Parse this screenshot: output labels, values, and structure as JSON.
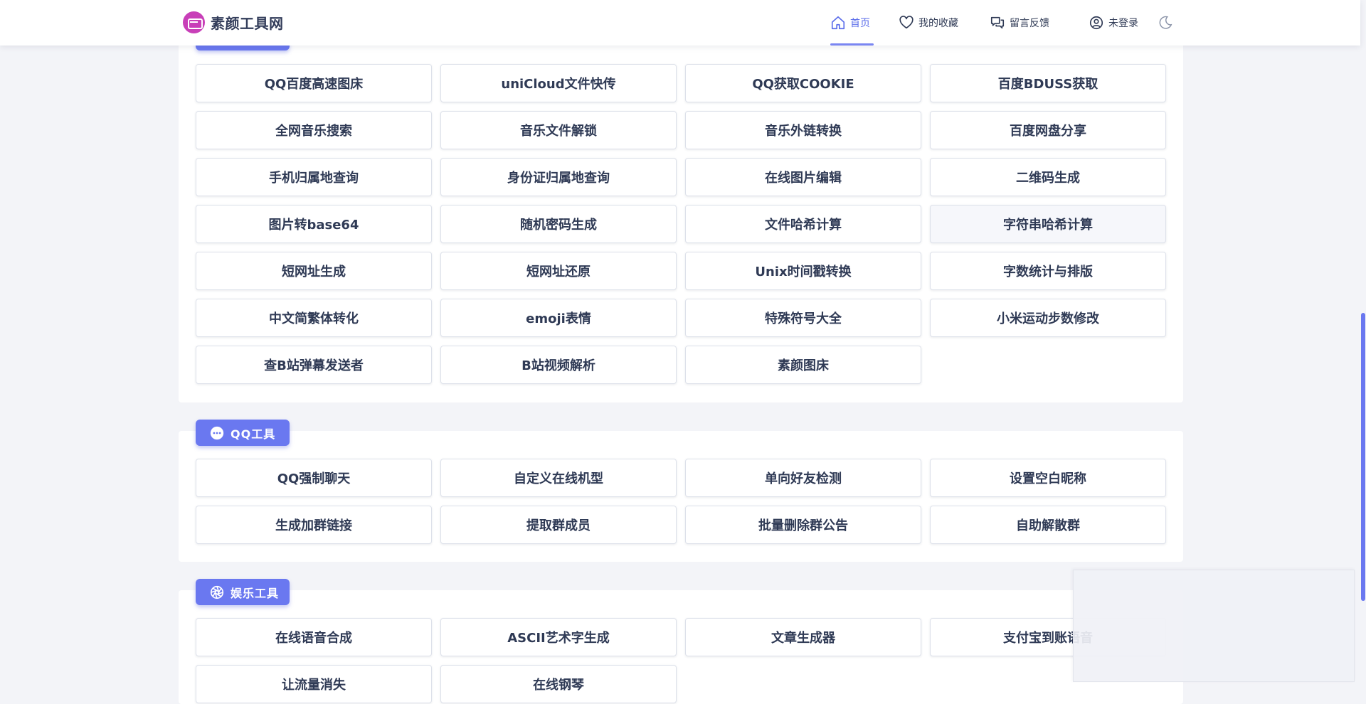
{
  "site": {
    "title": "素颜工具网",
    "accent": "#6a78f0",
    "logo_color": "#c83fb8"
  },
  "nav": [
    {
      "label": "首页",
      "icon": "home-icon"
    },
    {
      "label": "我的收藏",
      "icon": "heart-icon"
    },
    {
      "label": "留言反馈",
      "icon": "chat-icon"
    },
    {
      "label": "未登录",
      "icon": "user-icon"
    },
    {
      "icon": "moon-icon"
    }
  ],
  "sections": [
    {
      "title": "",
      "items": [
        "QQ百度高速图床",
        "uniCloud文件快传",
        "QQ获取COOKIE",
        "百度BDUSS获取",
        "全网音乐搜索",
        "音乐文件解锁",
        "音乐外链转换",
        "百度网盘分享",
        "手机归属地查询",
        "身份证归属地查询",
        "在线图片编辑",
        "二维码生成",
        "图片转base64",
        "随机密码生成",
        "文件哈希计算",
        "字符串哈希计算",
        "短网址生成",
        "短网址还原",
        "Unix时间戳转换",
        "字数统计与排版",
        "中文简繁体转化",
        "emoji表情",
        "特殊符号大全",
        "小米运动步数修改",
        "查B站弹幕发送者",
        "B站视频解析",
        "素颜图床"
      ]
    },
    {
      "title": "QQ工具",
      "icon": "chat-bubble-icon",
      "items": [
        "QQ强制聊天",
        "自定义在线机型",
        "单向好友检测",
        "设置空白昵称",
        "生成加群链接",
        "提取群成员",
        "批量删除群公告",
        "自助解散群"
      ]
    },
    {
      "title": "娱乐工具",
      "icon": "aperture-icon",
      "items": [
        "在线语音合成",
        "ASCII艺术字生成",
        "文章生成器",
        "支付宝到账语音",
        "让流量消失",
        "在线钢琴"
      ]
    }
  ]
}
